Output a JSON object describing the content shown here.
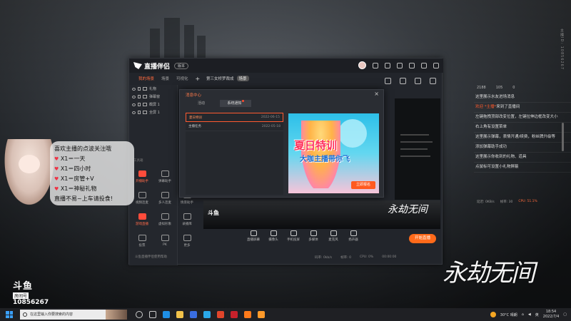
{
  "app": {
    "name": "直播伴侣",
    "version_badge": "版本",
    "tabs": [
      "我的场景",
      "场景",
      "可视化"
    ],
    "scene_info": {
      "title": "第三女桥罗裁成",
      "pill": "场景"
    },
    "sources": [
      {
        "label": "礼物"
      },
      {
        "label": "弹幕窗"
      },
      {
        "label": "截屏 1"
      },
      {
        "label": "全屏 1"
      }
    ],
    "tools_header": "工具箱",
    "tools": [
      {
        "label": "开播助手",
        "style": "red"
      },
      {
        "label": "弹幕助手",
        "style": ""
      },
      {
        "label": "视频连麦",
        "style": ""
      },
      {
        "label": "多人连麦",
        "style": ""
      },
      {
        "label": "情景助手",
        "style": ""
      },
      {
        "label": "游戏直播",
        "style": "red"
      },
      {
        "label": "虚拟形象",
        "style": ""
      },
      {
        "label": "录播库",
        "style": ""
      },
      {
        "label": "投票",
        "style": ""
      },
      {
        "label": "PK",
        "style": ""
      },
      {
        "label": "更多",
        "style": ""
      }
    ],
    "footer_note": "斗鱼直播伴侣使用帮助",
    "bottom_bar": [
      {
        "label": "直播屏幕"
      },
      {
        "label": "摄像头"
      },
      {
        "label": "手机投屏"
      },
      {
        "label": "多媒体"
      },
      {
        "label": "麦克风"
      },
      {
        "label": "扬声器"
      }
    ],
    "start_button": "开始直播",
    "status": {
      "bitrate": "码率: 0kb/s",
      "fps": "帧率: 0",
      "cpu": "CPU: 0%",
      "time": "00:00:00"
    },
    "preview_logo": "永劫无间",
    "preview_brand": "斗鱼"
  },
  "dialog": {
    "title": "消息中心",
    "tabs": [
      "活动",
      "系统通知"
    ],
    "messages": [
      {
        "title": "夏日特训",
        "date": "2022-06-15",
        "selected": true
      },
      {
        "title": "主播任务",
        "date": "2022-05-18",
        "selected": false
      }
    ],
    "banner": {
      "line1": "夏日特训",
      "line2": "大咖主播带你飞",
      "button": "立即报名"
    }
  },
  "sticker": {
    "lines": [
      "喜欢主播的点波关注哦",
      "X1＝一天",
      "X1＝四小时",
      "X1＝房管+V",
      "X1＝神秘礼物",
      "直播不易~上车请投食!"
    ]
  },
  "chat": {
    "header": [
      "2188",
      "105",
      "0"
    ],
    "messages": [
      {
        "name": "",
        "text": "这里展示水友进场消息"
      },
      {
        "name": "欢迎 *主播*",
        "text": "来到了直播间"
      },
      {
        "name": "",
        "text": "左键拖拽顶部改变位置，左键拉伸边框改变大小"
      },
      {
        "name": "",
        "text": "右上角有设置菜单"
      },
      {
        "name": "",
        "text": "这里展示弹幕，表情开通/续费，粉丝牌升级等"
      },
      {
        "name": "",
        "text": "添加弹幕助手成功"
      },
      {
        "name": "",
        "text": "这里展示你收到的礼物、道具"
      },
      {
        "name": "",
        "text": "点鼠标可设置小礼物屏蔽"
      }
    ],
    "footer": {
      "rate": "延迟: 0KB/s",
      "fps": "帧率: 30",
      "cpu": "CPU: 51.1%"
    }
  },
  "overlay": {
    "brand": "斗鱼",
    "room_label": "房间号",
    "room_number": "10856267",
    "game_logo": "永劫无间",
    "side_text": "主播ID: 10856267"
  },
  "taskbar": {
    "search_placeholder": "在这里输入你要搜索的内容",
    "weather": "30°C 晴朗",
    "time": "18:54",
    "date": "2022/7/4",
    "lang": "英"
  }
}
